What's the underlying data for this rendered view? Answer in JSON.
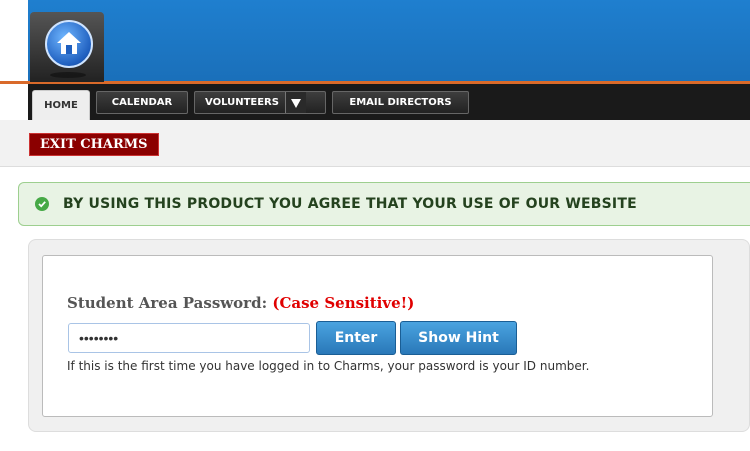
{
  "nav": {
    "tabs": [
      {
        "label": "HOME"
      },
      {
        "label": "CALENDAR"
      },
      {
        "label": "VOLUNTEERS"
      },
      {
        "label": "EMAIL DIRECTORS"
      }
    ]
  },
  "toolbar": {
    "exit_label": "EXIT CHARMS"
  },
  "banner": {
    "text": "BY USING THIS PRODUCT YOU AGREE THAT YOUR USE OF OUR WEBSITE"
  },
  "login": {
    "label": "Student Area Password:",
    "case_note": "(Case Sensitive!)",
    "password_value": "••••••••",
    "enter_label": "Enter",
    "hint_label": "Show Hint",
    "help_text": "If this is the first time you have logged in to Charms, your password is your ID number."
  },
  "colors": {
    "header_blue": "#1f7fcf",
    "exit_red": "#8b0000",
    "warning_red": "#e00000",
    "banner_green": "#e8f3e4"
  }
}
